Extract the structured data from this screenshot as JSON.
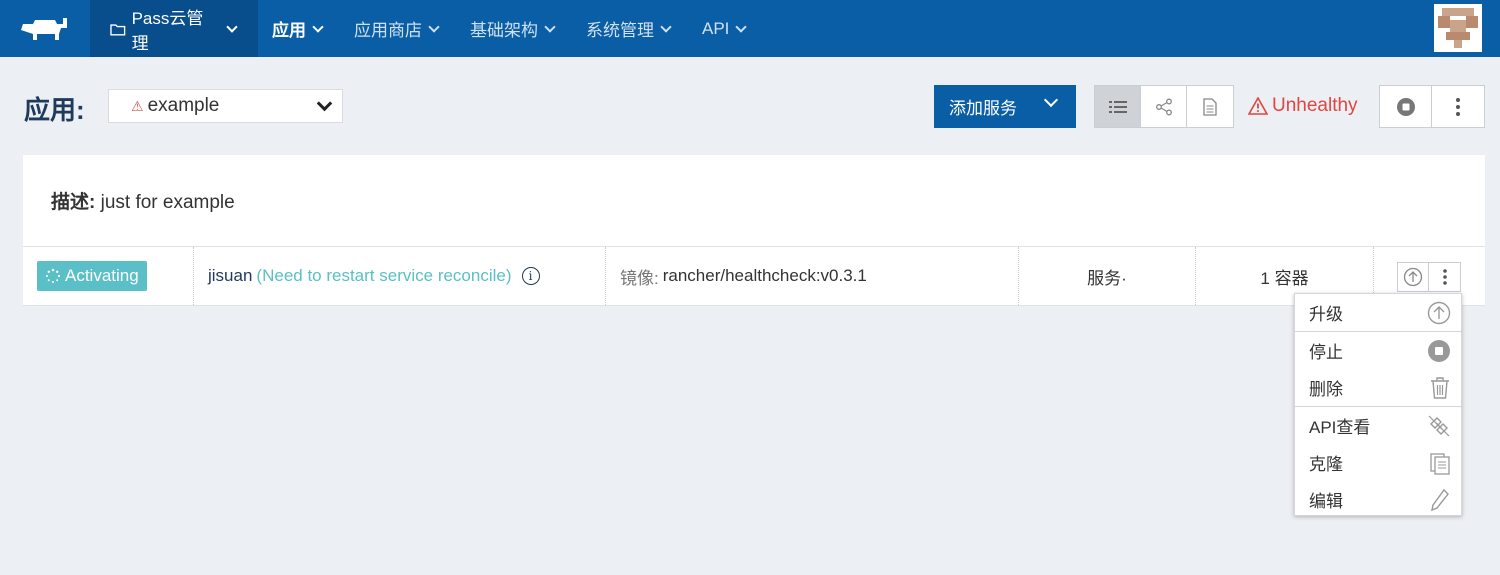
{
  "nav": {
    "environment": "Pass云管理",
    "items": [
      {
        "label": "应用",
        "active": true
      },
      {
        "label": "应用商店",
        "active": false
      },
      {
        "label": "基础架构",
        "active": false
      },
      {
        "label": "系统管理",
        "active": false
      },
      {
        "label": "API",
        "active": false
      }
    ]
  },
  "header": {
    "title": "应用:",
    "stack_name": "example",
    "add_service_label": "添加服务",
    "health_label": "Unhealthy"
  },
  "description": {
    "label": "描述:",
    "text": "just for example"
  },
  "service": {
    "state": "Activating",
    "name": "jisuan",
    "note": "(Need to restart service reconcile)",
    "image_label": "镜像:",
    "image_value": "rancher/healthcheck:v0.3.1",
    "kind": "服务·",
    "containers": "1 容器"
  },
  "menu": {
    "items": [
      {
        "label": "升级",
        "icon": "arrow-up-circle-icon"
      },
      {
        "label": "停止",
        "icon": "stop-icon"
      },
      {
        "label": "删除",
        "icon": "trash-icon"
      },
      {
        "label": "API查看",
        "icon": "link-icon"
      },
      {
        "label": "克隆",
        "icon": "copy-icon"
      },
      {
        "label": "编辑",
        "icon": "pencil-icon"
      }
    ]
  },
  "colors": {
    "nav_bg": "#0a5ea6",
    "accent_teal": "#5bbfc7",
    "danger": "#e0453f"
  }
}
